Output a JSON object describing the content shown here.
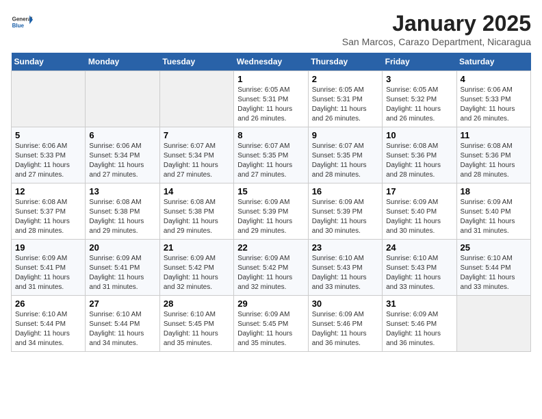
{
  "logo": {
    "text_general": "General",
    "text_blue": "Blue"
  },
  "title": "January 2025",
  "location": "San Marcos, Carazo Department, Nicaragua",
  "weekdays": [
    "Sunday",
    "Monday",
    "Tuesday",
    "Wednesday",
    "Thursday",
    "Friday",
    "Saturday"
  ],
  "weeks": [
    [
      {
        "day": "",
        "sunrise": "",
        "sunset": "",
        "daylight": "",
        "empty": true
      },
      {
        "day": "",
        "sunrise": "",
        "sunset": "",
        "daylight": "",
        "empty": true
      },
      {
        "day": "",
        "sunrise": "",
        "sunset": "",
        "daylight": "",
        "empty": true
      },
      {
        "day": "1",
        "sunrise": "Sunrise: 6:05 AM",
        "sunset": "Sunset: 5:31 PM",
        "daylight": "Daylight: 11 hours and 26 minutes.",
        "empty": false
      },
      {
        "day": "2",
        "sunrise": "Sunrise: 6:05 AM",
        "sunset": "Sunset: 5:31 PM",
        "daylight": "Daylight: 11 hours and 26 minutes.",
        "empty": false
      },
      {
        "day": "3",
        "sunrise": "Sunrise: 6:05 AM",
        "sunset": "Sunset: 5:32 PM",
        "daylight": "Daylight: 11 hours and 26 minutes.",
        "empty": false
      },
      {
        "day": "4",
        "sunrise": "Sunrise: 6:06 AM",
        "sunset": "Sunset: 5:33 PM",
        "daylight": "Daylight: 11 hours and 26 minutes.",
        "empty": false
      }
    ],
    [
      {
        "day": "5",
        "sunrise": "Sunrise: 6:06 AM",
        "sunset": "Sunset: 5:33 PM",
        "daylight": "Daylight: 11 hours and 27 minutes.",
        "empty": false
      },
      {
        "day": "6",
        "sunrise": "Sunrise: 6:06 AM",
        "sunset": "Sunset: 5:34 PM",
        "daylight": "Daylight: 11 hours and 27 minutes.",
        "empty": false
      },
      {
        "day": "7",
        "sunrise": "Sunrise: 6:07 AM",
        "sunset": "Sunset: 5:34 PM",
        "daylight": "Daylight: 11 hours and 27 minutes.",
        "empty": false
      },
      {
        "day": "8",
        "sunrise": "Sunrise: 6:07 AM",
        "sunset": "Sunset: 5:35 PM",
        "daylight": "Daylight: 11 hours and 27 minutes.",
        "empty": false
      },
      {
        "day": "9",
        "sunrise": "Sunrise: 6:07 AM",
        "sunset": "Sunset: 5:35 PM",
        "daylight": "Daylight: 11 hours and 28 minutes.",
        "empty": false
      },
      {
        "day": "10",
        "sunrise": "Sunrise: 6:08 AM",
        "sunset": "Sunset: 5:36 PM",
        "daylight": "Daylight: 11 hours and 28 minutes.",
        "empty": false
      },
      {
        "day": "11",
        "sunrise": "Sunrise: 6:08 AM",
        "sunset": "Sunset: 5:36 PM",
        "daylight": "Daylight: 11 hours and 28 minutes.",
        "empty": false
      }
    ],
    [
      {
        "day": "12",
        "sunrise": "Sunrise: 6:08 AM",
        "sunset": "Sunset: 5:37 PM",
        "daylight": "Daylight: 11 hours and 28 minutes.",
        "empty": false
      },
      {
        "day": "13",
        "sunrise": "Sunrise: 6:08 AM",
        "sunset": "Sunset: 5:38 PM",
        "daylight": "Daylight: 11 hours and 29 minutes.",
        "empty": false
      },
      {
        "day": "14",
        "sunrise": "Sunrise: 6:08 AM",
        "sunset": "Sunset: 5:38 PM",
        "daylight": "Daylight: 11 hours and 29 minutes.",
        "empty": false
      },
      {
        "day": "15",
        "sunrise": "Sunrise: 6:09 AM",
        "sunset": "Sunset: 5:39 PM",
        "daylight": "Daylight: 11 hours and 29 minutes.",
        "empty": false
      },
      {
        "day": "16",
        "sunrise": "Sunrise: 6:09 AM",
        "sunset": "Sunset: 5:39 PM",
        "daylight": "Daylight: 11 hours and 30 minutes.",
        "empty": false
      },
      {
        "day": "17",
        "sunrise": "Sunrise: 6:09 AM",
        "sunset": "Sunset: 5:40 PM",
        "daylight": "Daylight: 11 hours and 30 minutes.",
        "empty": false
      },
      {
        "day": "18",
        "sunrise": "Sunrise: 6:09 AM",
        "sunset": "Sunset: 5:40 PM",
        "daylight": "Daylight: 11 hours and 31 minutes.",
        "empty": false
      }
    ],
    [
      {
        "day": "19",
        "sunrise": "Sunrise: 6:09 AM",
        "sunset": "Sunset: 5:41 PM",
        "daylight": "Daylight: 11 hours and 31 minutes.",
        "empty": false
      },
      {
        "day": "20",
        "sunrise": "Sunrise: 6:09 AM",
        "sunset": "Sunset: 5:41 PM",
        "daylight": "Daylight: 11 hours and 31 minutes.",
        "empty": false
      },
      {
        "day": "21",
        "sunrise": "Sunrise: 6:09 AM",
        "sunset": "Sunset: 5:42 PM",
        "daylight": "Daylight: 11 hours and 32 minutes.",
        "empty": false
      },
      {
        "day": "22",
        "sunrise": "Sunrise: 6:09 AM",
        "sunset": "Sunset: 5:42 PM",
        "daylight": "Daylight: 11 hours and 32 minutes.",
        "empty": false
      },
      {
        "day": "23",
        "sunrise": "Sunrise: 6:10 AM",
        "sunset": "Sunset: 5:43 PM",
        "daylight": "Daylight: 11 hours and 33 minutes.",
        "empty": false
      },
      {
        "day": "24",
        "sunrise": "Sunrise: 6:10 AM",
        "sunset": "Sunset: 5:43 PM",
        "daylight": "Daylight: 11 hours and 33 minutes.",
        "empty": false
      },
      {
        "day": "25",
        "sunrise": "Sunrise: 6:10 AM",
        "sunset": "Sunset: 5:44 PM",
        "daylight": "Daylight: 11 hours and 33 minutes.",
        "empty": false
      }
    ],
    [
      {
        "day": "26",
        "sunrise": "Sunrise: 6:10 AM",
        "sunset": "Sunset: 5:44 PM",
        "daylight": "Daylight: 11 hours and 34 minutes.",
        "empty": false
      },
      {
        "day": "27",
        "sunrise": "Sunrise: 6:10 AM",
        "sunset": "Sunset: 5:44 PM",
        "daylight": "Daylight: 11 hours and 34 minutes.",
        "empty": false
      },
      {
        "day": "28",
        "sunrise": "Sunrise: 6:10 AM",
        "sunset": "Sunset: 5:45 PM",
        "daylight": "Daylight: 11 hours and 35 minutes.",
        "empty": false
      },
      {
        "day": "29",
        "sunrise": "Sunrise: 6:09 AM",
        "sunset": "Sunset: 5:45 PM",
        "daylight": "Daylight: 11 hours and 35 minutes.",
        "empty": false
      },
      {
        "day": "30",
        "sunrise": "Sunrise: 6:09 AM",
        "sunset": "Sunset: 5:46 PM",
        "daylight": "Daylight: 11 hours and 36 minutes.",
        "empty": false
      },
      {
        "day": "31",
        "sunrise": "Sunrise: 6:09 AM",
        "sunset": "Sunset: 5:46 PM",
        "daylight": "Daylight: 11 hours and 36 minutes.",
        "empty": false
      },
      {
        "day": "",
        "sunrise": "",
        "sunset": "",
        "daylight": "",
        "empty": true
      }
    ]
  ]
}
